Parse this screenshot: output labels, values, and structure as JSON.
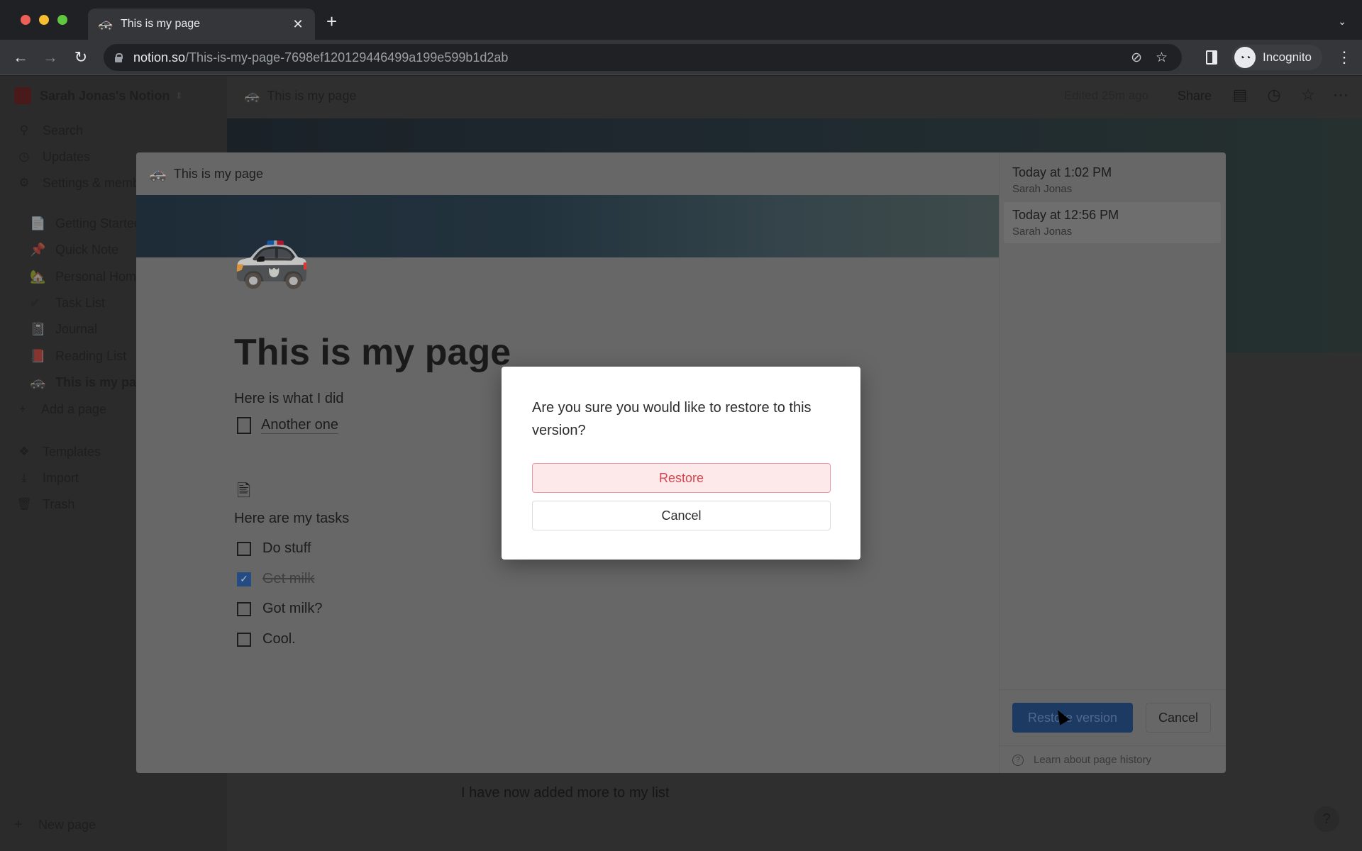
{
  "browser": {
    "tab_title": "This is my page",
    "tab_favicon": "🚓",
    "url_host": "notion.so",
    "url_path": "/This-is-my-page-7698ef120129446499a199e599b1d2ab",
    "profile_label": "Incognito"
  },
  "sidebar": {
    "workspace_name": "Sarah Jonas's Notion",
    "nav": [
      {
        "icon": "search-icon",
        "glyph": "⚲",
        "label": "Search"
      },
      {
        "icon": "clock-icon",
        "glyph": "◷",
        "label": "Updates"
      },
      {
        "icon": "gear-icon",
        "glyph": "⚙",
        "label": "Settings & members"
      }
    ],
    "pages": [
      {
        "emoji": "📄",
        "label": "Getting Started"
      },
      {
        "emoji": "📌",
        "label": "Quick Note"
      },
      {
        "emoji": "🏡",
        "label": "Personal Home"
      },
      {
        "emoji": "✔",
        "label": "Task List"
      },
      {
        "emoji": "📓",
        "label": "Journal"
      },
      {
        "emoji": "📕",
        "label": "Reading List"
      },
      {
        "emoji": "🚓",
        "label": "This is my page"
      }
    ],
    "add_page": "Add a page",
    "tools": [
      {
        "icon": "templates-icon",
        "glyph": "❖",
        "label": "Templates"
      },
      {
        "icon": "import-icon",
        "glyph": "⤓",
        "label": "Import"
      },
      {
        "icon": "trash-icon",
        "glyph": "🗑",
        "label": "Trash"
      }
    ],
    "new_page": "New page"
  },
  "topbar": {
    "breadcrumb": "This is my page",
    "breadcrumb_emoji": "🚓",
    "edited": "Edited 25m ago",
    "share": "Share"
  },
  "background": {
    "text": "I have now added more to my list",
    "help": "?"
  },
  "history": {
    "header_title": "This is my page",
    "header_emoji": "🚓",
    "page_icon": "🚓",
    "page_title": "This is my page",
    "intro": "Here is what I did",
    "link_page": "Another one",
    "tasks_heading": "Here are my tasks",
    "todos": [
      {
        "label": "Do stuff",
        "checked": false
      },
      {
        "label": "Get milk",
        "checked": true
      },
      {
        "label": "Got milk?",
        "checked": false
      },
      {
        "label": "Cool.",
        "checked": false
      }
    ],
    "versions": [
      {
        "time": "Today at 1:02 PM",
        "author": "Sarah Jonas",
        "selected": false
      },
      {
        "time": "Today at 12:56 PM",
        "author": "Sarah Jonas",
        "selected": true
      }
    ],
    "restore_version": "Restore version",
    "cancel": "Cancel",
    "learn": "Learn about page history"
  },
  "confirm": {
    "message": "Are you sure you would like to restore to this version?",
    "restore": "Restore",
    "cancel": "Cancel"
  },
  "colors": {
    "restore_text": "#d5454f",
    "restore_bg": "#fde8ea",
    "primary_blue": "#2383e2"
  }
}
